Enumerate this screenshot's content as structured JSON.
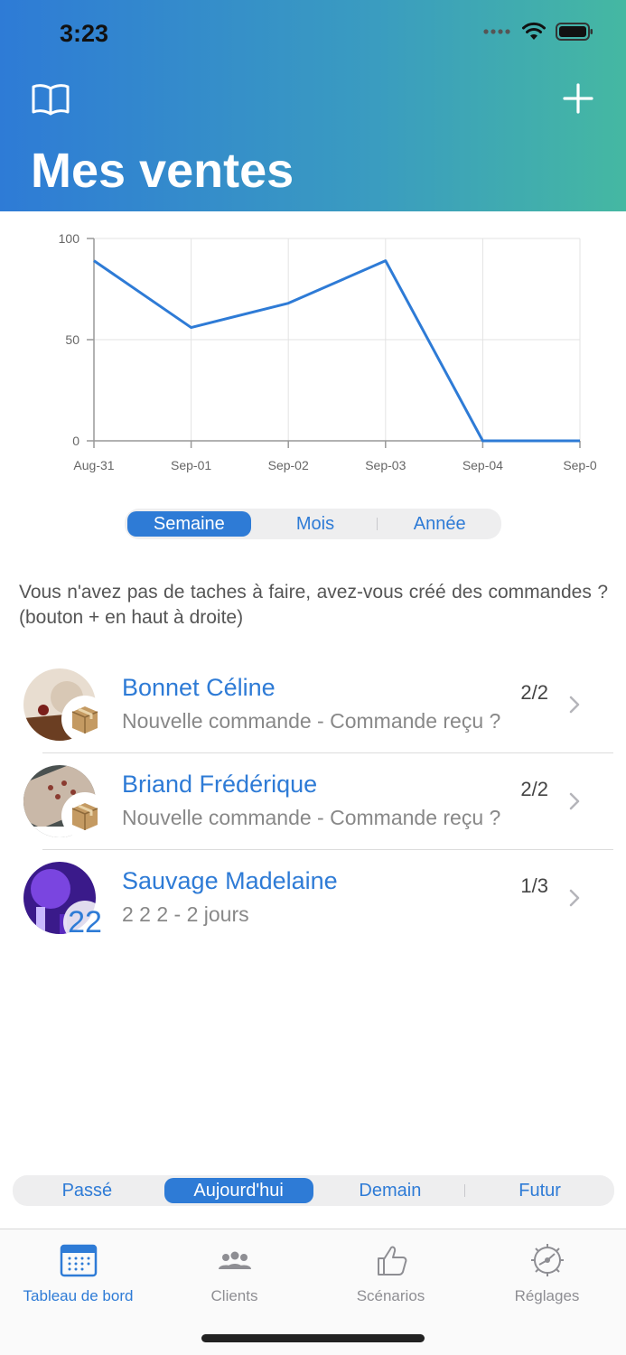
{
  "status_bar": {
    "time": "3:23"
  },
  "header": {
    "title": "Mes ventes",
    "book_icon": "book-icon",
    "add_icon": "plus-icon",
    "gradient_start": "#2e7bd6",
    "gradient_end": "#45b8a2"
  },
  "chart_data": {
    "type": "line",
    "x": [
      "Aug-31",
      "Sep-01",
      "Sep-02",
      "Sep-03",
      "Sep-04",
      "Sep-0"
    ],
    "values": [
      89,
      56,
      68,
      89,
      0,
      0
    ],
    "y_ticks": [
      "100",
      "50",
      "0"
    ],
    "ylim": [
      0,
      100
    ],
    "grid": true,
    "line_color": "#2e7bd6"
  },
  "period_segment": {
    "items": [
      "Semaine",
      "Mois",
      "Année"
    ],
    "active": 0
  },
  "info_text": "Vous n'avez pas de taches à faire, avez-vous créé des commandes ? (bouton + en haut à droite)",
  "list": [
    {
      "name": "Bonnet Céline",
      "subtitle": "Nouvelle commande - Commande reçu ?",
      "count": "2/2",
      "badge": "box-icon"
    },
    {
      "name": "Briand Frédérique",
      "subtitle": "Nouvelle commande - Commande reçu ?",
      "count": "2/2",
      "badge": "box-icon"
    },
    {
      "name": "Sauvage Madelaine",
      "subtitle": "2 2 2 - 2 jours",
      "count": "1/3",
      "badge_text": "22"
    }
  ],
  "day_segment": {
    "items": [
      "Passé",
      "Aujourd'hui",
      "Demain",
      "Futur"
    ],
    "active": 1
  },
  "tabbar": {
    "tabs": [
      {
        "label": "Tableau de bord",
        "icon": "calendar-icon"
      },
      {
        "label": "Clients",
        "icon": "people-icon"
      },
      {
        "label": "Scénarios",
        "icon": "thumbs-up-icon"
      },
      {
        "label": "Réglages",
        "icon": "gear-icon"
      }
    ],
    "active": 0
  },
  "colors": {
    "accent": "#2e7bd6",
    "inactive": "#8e8e93"
  }
}
